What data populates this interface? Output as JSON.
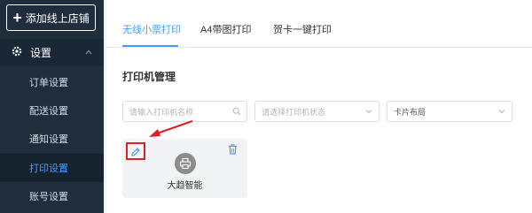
{
  "sidebar": {
    "add_shop_label": "添加线上店铺",
    "group_label": "设置",
    "items": [
      {
        "label": "订单设置",
        "active": false
      },
      {
        "label": "配送设置",
        "active": false
      },
      {
        "label": "通知设置",
        "active": false
      },
      {
        "label": "打印设置",
        "active": true
      },
      {
        "label": "账号设置",
        "active": false
      }
    ]
  },
  "tabs": [
    {
      "label": "无线小票打印",
      "active": true
    },
    {
      "label": "A4带图打印",
      "active": false
    },
    {
      "label": "贺卡一键打印",
      "active": false
    }
  ],
  "section_title": "打印机管理",
  "filters": {
    "name_placeholder": "请输入打印机名称",
    "status_placeholder": "请选择打印机状态",
    "layout_value": "卡片布局"
  },
  "printer_card": {
    "name": "大趋智能"
  },
  "colors": {
    "accent": "#409eff",
    "sidebar_bg": "#1f2d3d",
    "highlight_red": "#e02020"
  }
}
